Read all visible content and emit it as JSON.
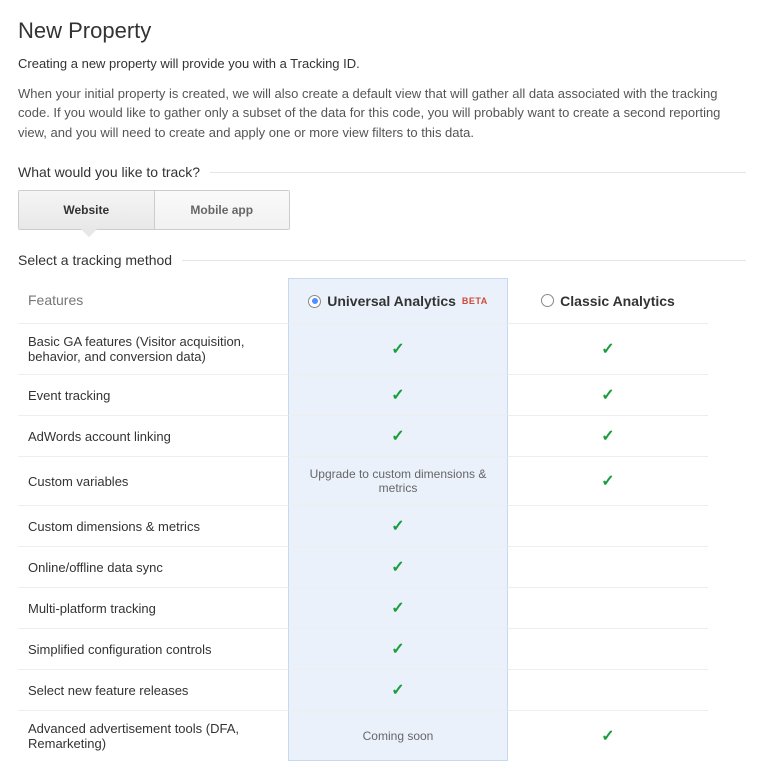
{
  "title": "New Property",
  "intro1": "Creating a new property will provide you with a Tracking ID.",
  "intro2": "When your initial property is created, we will also create a default view that will gather all data associated with the tracking code. If you would like to gather only a subset of the data for this code, you will probably want to create a second reporting view, and you will need to create and apply one or more view filters to this data.",
  "track_label": "What would you like to track?",
  "tabs": {
    "website": "Website",
    "mobile": "Mobile app"
  },
  "method_label": "Select a tracking method",
  "columns": {
    "features": "Features",
    "universal": "Universal Analytics",
    "beta": "BETA",
    "classic": "Classic Analytics"
  },
  "rows": [
    {
      "label": "Basic GA features (Visitor acquisition, behavior, and conversion data)",
      "u": "check",
      "c": "check"
    },
    {
      "label": "Event tracking",
      "u": "check",
      "c": "check"
    },
    {
      "label": "AdWords account linking",
      "u": "check",
      "c": "check"
    },
    {
      "label": "Custom variables",
      "u": "Upgrade to custom dimensions & metrics",
      "c": "check"
    },
    {
      "label": "Custom dimensions & metrics",
      "u": "check",
      "c": ""
    },
    {
      "label": "Online/offline data sync",
      "u": "check",
      "c": ""
    },
    {
      "label": "Multi-platform tracking",
      "u": "check",
      "c": ""
    },
    {
      "label": "Simplified configuration controls",
      "u": "check",
      "c": ""
    },
    {
      "label": "Select new feature releases",
      "u": "check",
      "c": ""
    },
    {
      "label": "Advanced advertisement tools (DFA, Remarketing)",
      "u": "Coming soon",
      "c": "check"
    }
  ]
}
